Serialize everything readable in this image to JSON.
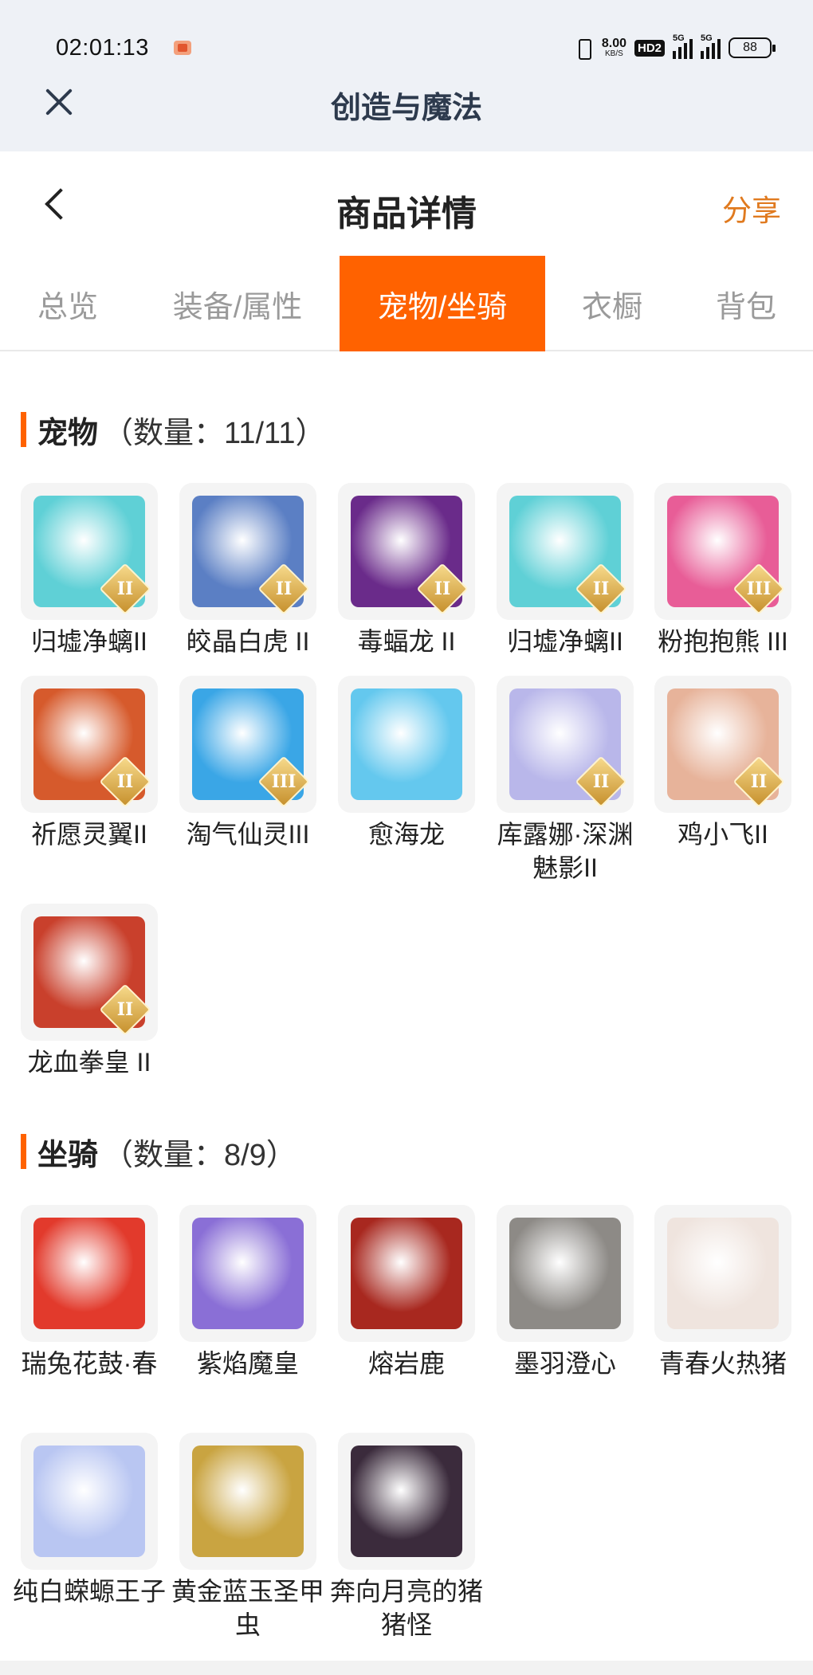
{
  "status_bar": {
    "time": "02:01:13",
    "net_speed": "8.00",
    "net_unit": "KB/S",
    "hd": "HD2",
    "sig1": "5G",
    "sig2": "5G",
    "battery": "88"
  },
  "mini_app": {
    "title": "创造与魔法"
  },
  "header": {
    "title": "商品详情",
    "share": "分享"
  },
  "tabs": [
    {
      "label": "总览"
    },
    {
      "label": "装备/属性"
    },
    {
      "label": "宠物/坐骑",
      "active": true
    },
    {
      "label": "衣橱"
    },
    {
      "label": "背包"
    }
  ],
  "pets": {
    "name": "宠物",
    "count": "（数量：11/11）",
    "items": [
      {
        "label": "归墟净螭II",
        "icon": "cyan-dragon",
        "color": "#5fd0d6",
        "badge": "II"
      },
      {
        "label": "皎晶白虎 II",
        "icon": "white-tiger",
        "color": "#5b7fc4",
        "badge": "II"
      },
      {
        "label": "毒蝠龙 II",
        "icon": "purple-dragon",
        "color": "#6a2b8a",
        "badge": "II"
      },
      {
        "label": "归墟净螭II",
        "icon": "cyan-dragon",
        "color": "#5fd0d6",
        "badge": "II"
      },
      {
        "label": "粉抱抱熊 III",
        "icon": "pink-bear",
        "color": "#e85d97",
        "badge": "III"
      },
      {
        "label": "祈愿灵翼II",
        "icon": "phoenix",
        "color": "#d65a2c",
        "badge": "II"
      },
      {
        "label": "淘气仙灵III",
        "icon": "blue-puppy",
        "color": "#3aa6e6",
        "badge": "III"
      },
      {
        "label": "愈海龙",
        "icon": "sea-dragon",
        "color": "#64c8ee",
        "badge": ""
      },
      {
        "label": "库露娜·深渊魅影II",
        "icon": "ghost-girl",
        "color": "#b9b7ea",
        "badge": "II"
      },
      {
        "label": "鸡小飞II",
        "icon": "chick",
        "color": "#e7b39a",
        "badge": "II"
      },
      {
        "label": "龙血拳皇 II",
        "icon": "dragon-boxer",
        "color": "#c9402c",
        "badge": "II"
      }
    ]
  },
  "mounts": {
    "name": "坐骑",
    "count": "（数量：8/9）",
    "items": [
      {
        "label": "瑞兔花鼓·春",
        "icon": "drum-rabbit",
        "color": "#e23a2c"
      },
      {
        "label": "紫焰魔皇",
        "icon": "purple-phoenix",
        "color": "#8a6fd6"
      },
      {
        "label": "熔岩鹿",
        "icon": "lava-deer",
        "color": "#a8281f"
      },
      {
        "label": "墨羽澄心",
        "icon": "ink-sword",
        "color": "#8d8a86"
      },
      {
        "label": "青春火热猪",
        "icon": "pig",
        "color": "#efe4de"
      },
      {
        "label": "纯白蝾螈王子",
        "icon": "axolotl",
        "color": "#b9c6f2"
      },
      {
        "label": "黄金蓝玉圣甲虫",
        "icon": "scarab",
        "color": "#c9a441"
      },
      {
        "label": "奔向月亮的猪猪怪",
        "icon": "moon-pig",
        "color": "#3b2b3c"
      }
    ]
  }
}
